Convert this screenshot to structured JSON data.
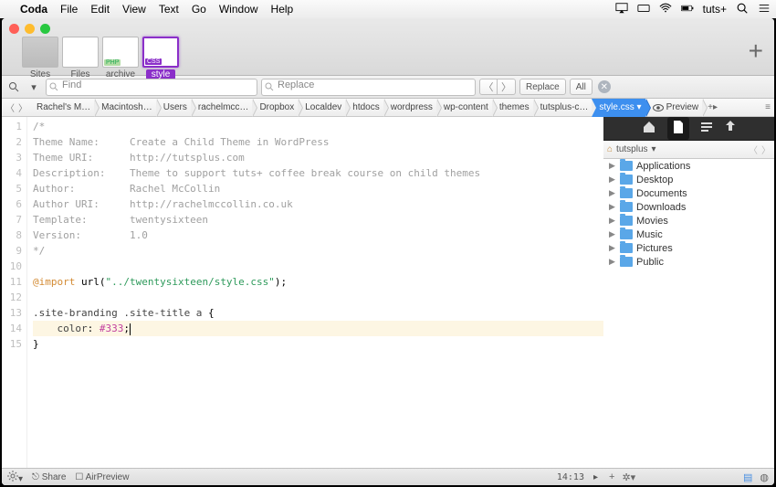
{
  "menubar": {
    "app": "Coda",
    "items": [
      "File",
      "Edit",
      "View",
      "Text",
      "Go",
      "Window",
      "Help"
    ],
    "right_user": "tuts+"
  },
  "tabs": [
    {
      "label": "Sites",
      "kind": "placeholder"
    },
    {
      "label": "Files",
      "kind": "doc"
    },
    {
      "label": "archive",
      "kind": "doc",
      "tag": "PHP"
    },
    {
      "label": "style",
      "kind": "doc",
      "tag": "CSS",
      "active": true
    }
  ],
  "find": {
    "placeholder": "Find"
  },
  "replace": {
    "placeholder": "Replace",
    "btn": "Replace",
    "btn_all": "All"
  },
  "breadcrumbs": [
    "Rachel's M…",
    "Macintosh…",
    "Users",
    "rachelmcc…",
    "Dropbox",
    "Localdev",
    "htdocs",
    "wordpress",
    "wp-content",
    "themes",
    "tutsplus-c…"
  ],
  "breadcrumb_active": "style.css",
  "breadcrumb_preview": "Preview",
  "code": {
    "lines": [
      "/*",
      "Theme Name:     Create a Child Theme in WordPress",
      "Theme URI:      http://tutsplus.com",
      "Description:    Theme to support tuts+ coffee break course on child themes",
      "Author:         Rachel McCollin",
      "Author URI:     http://rachelmccollin.co.uk",
      "Template:       twentysixteen",
      "Version:        1.0",
      "*/",
      "",
      "@import url(\"../twentysixteen/style.css\");",
      "",
      ".site-branding .site-title a {",
      "    color: #333;",
      "}"
    ],
    "highlight_line": 14
  },
  "status": {
    "share": "Share",
    "air": "AirPreview",
    "pos": "14:13"
  },
  "panel": {
    "root": "tutsplus",
    "folders": [
      "Applications",
      "Desktop",
      "Documents",
      "Downloads",
      "Movies",
      "Music",
      "Pictures",
      "Public"
    ]
  }
}
